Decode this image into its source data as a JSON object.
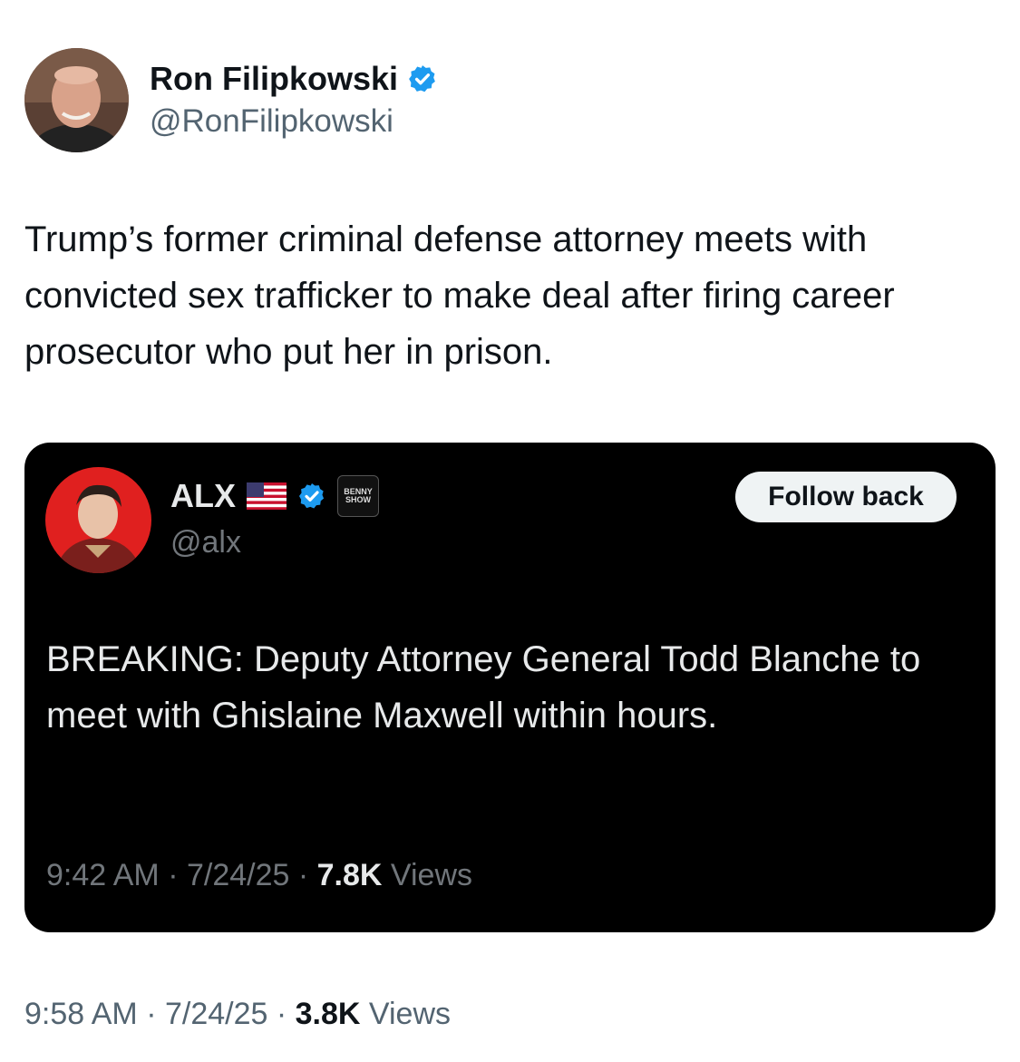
{
  "tweet": {
    "author_name": "Ron Filipkowski",
    "author_handle": "@RonFilipkowski",
    "text": "Trump’s former criminal defense attorney meets with convicted sex trafficker to make deal after firing career prosecutor who put her in prison.",
    "time": "9:58 AM",
    "date": "7/24/25",
    "views_count": "3.8K",
    "views_label": "Views",
    "separator": " · "
  },
  "quoted": {
    "author_name": "ALX",
    "author_handle": "@alx",
    "affiliate_badge_text": "BENNY SHOW",
    "follow_button": "Follow back",
    "text": "BREAKING: Deputy Attorney General Todd Blanche to meet with Ghislaine Maxwell within hours.",
    "time": "9:42 AM",
    "date": "7/24/25",
    "views_count": "7.8K",
    "views_label": "Views",
    "separator": " · "
  },
  "icons": {
    "verified": "verified-badge-icon",
    "flag": "us-flag-icon"
  },
  "colors": {
    "verified_blue": "#1d9bf0",
    "quote_card_bg": "#000000",
    "text_primary": "#0f1419",
    "text_secondary": "#536471"
  }
}
